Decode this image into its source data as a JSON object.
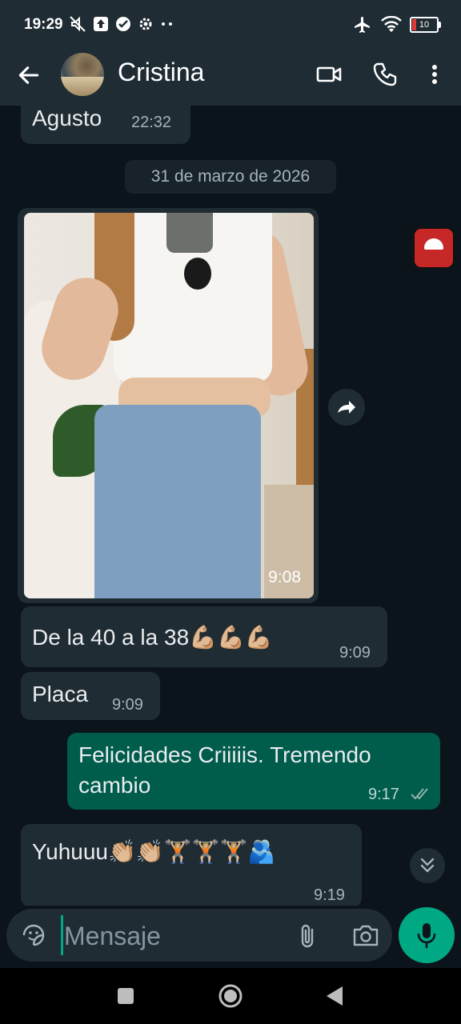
{
  "status_bar": {
    "time": "19:29",
    "battery": "10"
  },
  "header": {
    "contact_name": "Cristina"
  },
  "chat": {
    "prev_message": {
      "text": "Agusto",
      "time": "22:32"
    },
    "date_chip": "31 de marzo de 2026",
    "photo_message": {
      "time": "9:08"
    },
    "messages": [
      {
        "text": "De la 40 a la 38💪🏼💪🏼💪🏼",
        "time": "9:09",
        "direction": "in"
      },
      {
        "text": "Placa",
        "time": "9:09",
        "direction": "in"
      },
      {
        "text_line1": "Felicidades Criiiiis. Tremendo",
        "text_line2": "cambio",
        "time": "9:17",
        "direction": "out",
        "status": "read"
      },
      {
        "text": "Yuhuuu👏🏼👏🏼🏋🏼🏋🏼🏋🏼🫂",
        "time": "9:19",
        "direction": "in"
      }
    ]
  },
  "composer": {
    "placeholder": "Mensaje"
  },
  "colors": {
    "accent": "#00a884",
    "outgoing_bubble": "#005c4b",
    "incoming_bubble": "#202c33",
    "background": "#0b141a"
  }
}
